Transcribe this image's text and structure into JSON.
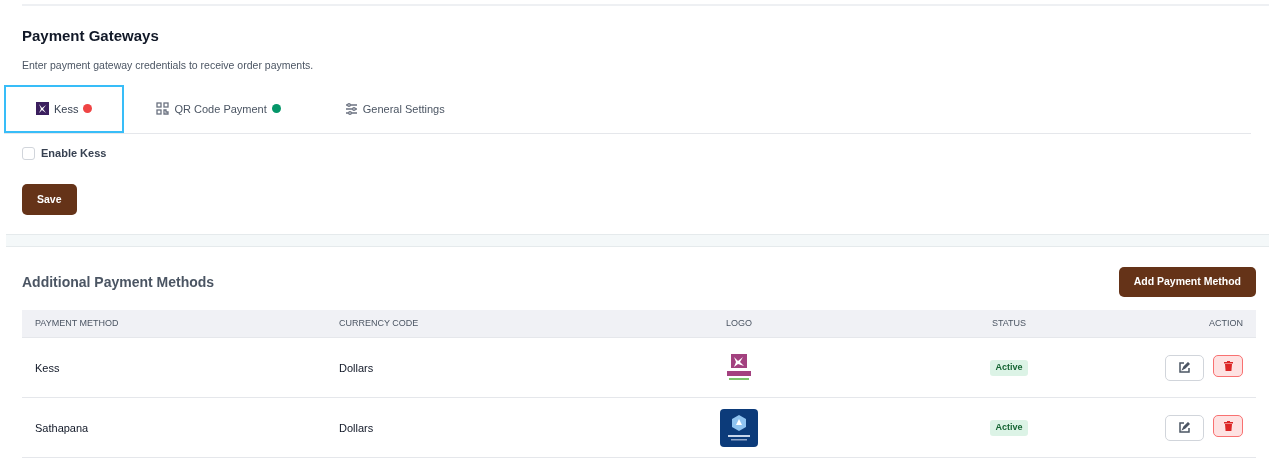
{
  "gateways": {
    "title": "Payment Gateways",
    "subtitle": "Enter payment gateway credentials to receive order payments.",
    "tabs": [
      {
        "kind": "kess",
        "label": "Kess",
        "selected": true,
        "color": "#ef4444"
      },
      {
        "kind": "qr",
        "label": "QR Code Payment",
        "selected": false,
        "color": "#059669"
      },
      {
        "kind": "settings",
        "label": "General Settings",
        "selected": false
      }
    ],
    "enable": {
      "label": "Enable Kess",
      "checked": false
    },
    "save": "Save"
  },
  "methods": {
    "title": "Additional Payment Methods",
    "add_button": "Add Payment Method",
    "columns": [
      "PAYMENT METHOD",
      "CURRENCY CODE",
      "LOGO",
      "STATUS",
      "ACTION"
    ],
    "rows": [
      {
        "method": "Kess",
        "currency": "Dollars",
        "kind": "kess",
        "status": "Active"
      },
      {
        "method": "Sathapana",
        "currency": "Dollars",
        "kind": "bank",
        "status": "Active"
      }
    ]
  }
}
